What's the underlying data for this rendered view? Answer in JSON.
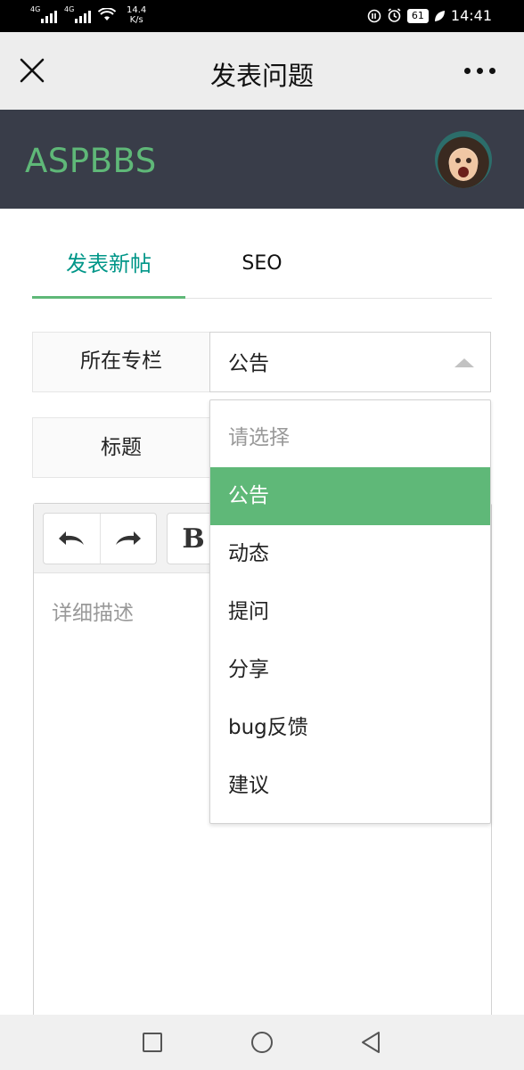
{
  "status_bar": {
    "signal1_tag": "4G",
    "signal2_tag": "4G",
    "net_speed_value": "14.4",
    "net_speed_unit": "K/s",
    "battery": "61",
    "time": "14:41"
  },
  "nav": {
    "title": "发表问题"
  },
  "brand": {
    "logo": "ASPBBS"
  },
  "tabs": [
    {
      "label": "发表新帖",
      "active": true
    },
    {
      "label": "SEO",
      "active": false
    }
  ],
  "form": {
    "column_label": "所在专栏",
    "column_value": "公告",
    "title_label": "标题",
    "description_placeholder": "详细描述"
  },
  "dropdown": {
    "placeholder": "请选择",
    "options": [
      "公告",
      "动态",
      "提问",
      "分享",
      "bug反馈",
      "建议"
    ],
    "selected": "公告"
  },
  "editor": {
    "bold_label": "B"
  },
  "colors": {
    "accent_green": "#5fb878",
    "tab_active_text": "#009688",
    "header_bg": "#393d49"
  },
  "icons": {
    "close": "close-icon",
    "more": "more-icon",
    "undo": "undo-icon",
    "redo": "redo-icon",
    "bold": "bold-icon",
    "home": "home-circle-icon",
    "recents": "recents-square-icon",
    "back": "back-triangle-icon"
  }
}
